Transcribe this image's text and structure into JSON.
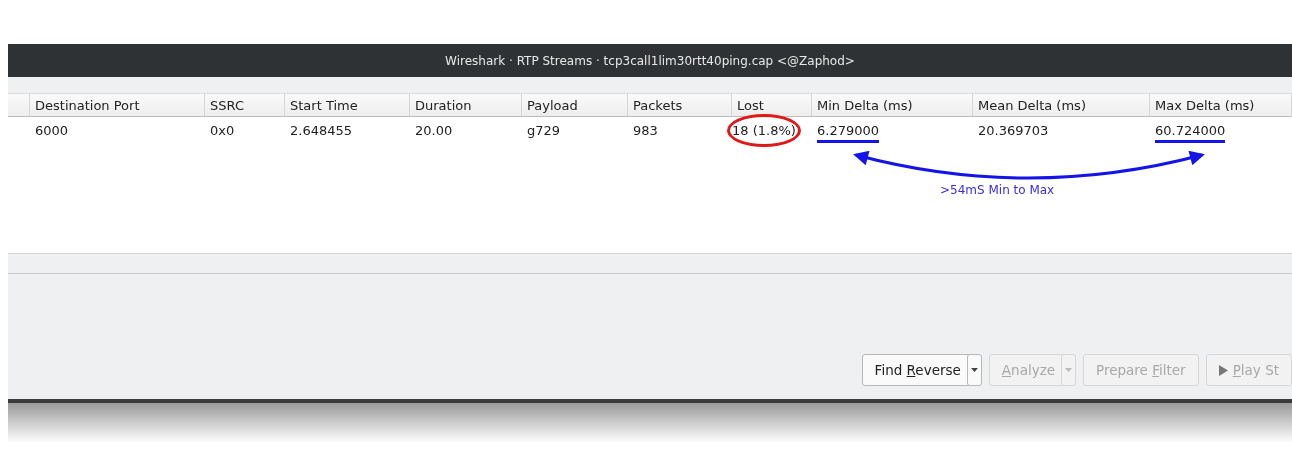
{
  "window": {
    "title": "Wireshark · RTP Streams · tcp3call1lim30rtt40ping.cap <@Zaphod>"
  },
  "table": {
    "columns": [
      "Destination Port",
      "SSRC",
      "Start Time",
      "Duration",
      "Payload",
      "Packets",
      "Lost",
      "Min Delta (ms)",
      "Mean Delta (ms)",
      "Max Delta (ms)"
    ],
    "rows": [
      {
        "cells": [
          {
            "text": "6000",
            "kind": "plain"
          },
          {
            "text": "0x0",
            "kind": "plain"
          },
          {
            "text": "2.648455",
            "kind": "plain"
          },
          {
            "text": "20.00",
            "kind": "plain"
          },
          {
            "text": "g729",
            "kind": "plain"
          },
          {
            "text": "983",
            "kind": "plain"
          },
          {
            "text": "18 (1.8%)",
            "kind": "circled"
          },
          {
            "text": "6.279000",
            "kind": "underlined"
          },
          {
            "text": "20.369703",
            "kind": "plain"
          },
          {
            "text": "60.724000",
            "kind": "underlined"
          }
        ]
      }
    ]
  },
  "annotation": {
    "label": ">54mS Min to Max"
  },
  "buttons": [
    {
      "before": "Find ",
      "key": "R",
      "after": "everse",
      "disabled": false,
      "dropdown": true,
      "kind": "text"
    },
    {
      "key": "A",
      "after": "nalyze",
      "disabled": true,
      "dropdown": true,
      "kind": "text"
    },
    {
      "before": "Prepare ",
      "key": "F",
      "after": "ilter",
      "disabled": true,
      "dropdown": false,
      "kind": "text"
    },
    {
      "key": "P",
      "after": "lay St",
      "disabled": true,
      "dropdown": false,
      "kind": "play"
    }
  ]
}
